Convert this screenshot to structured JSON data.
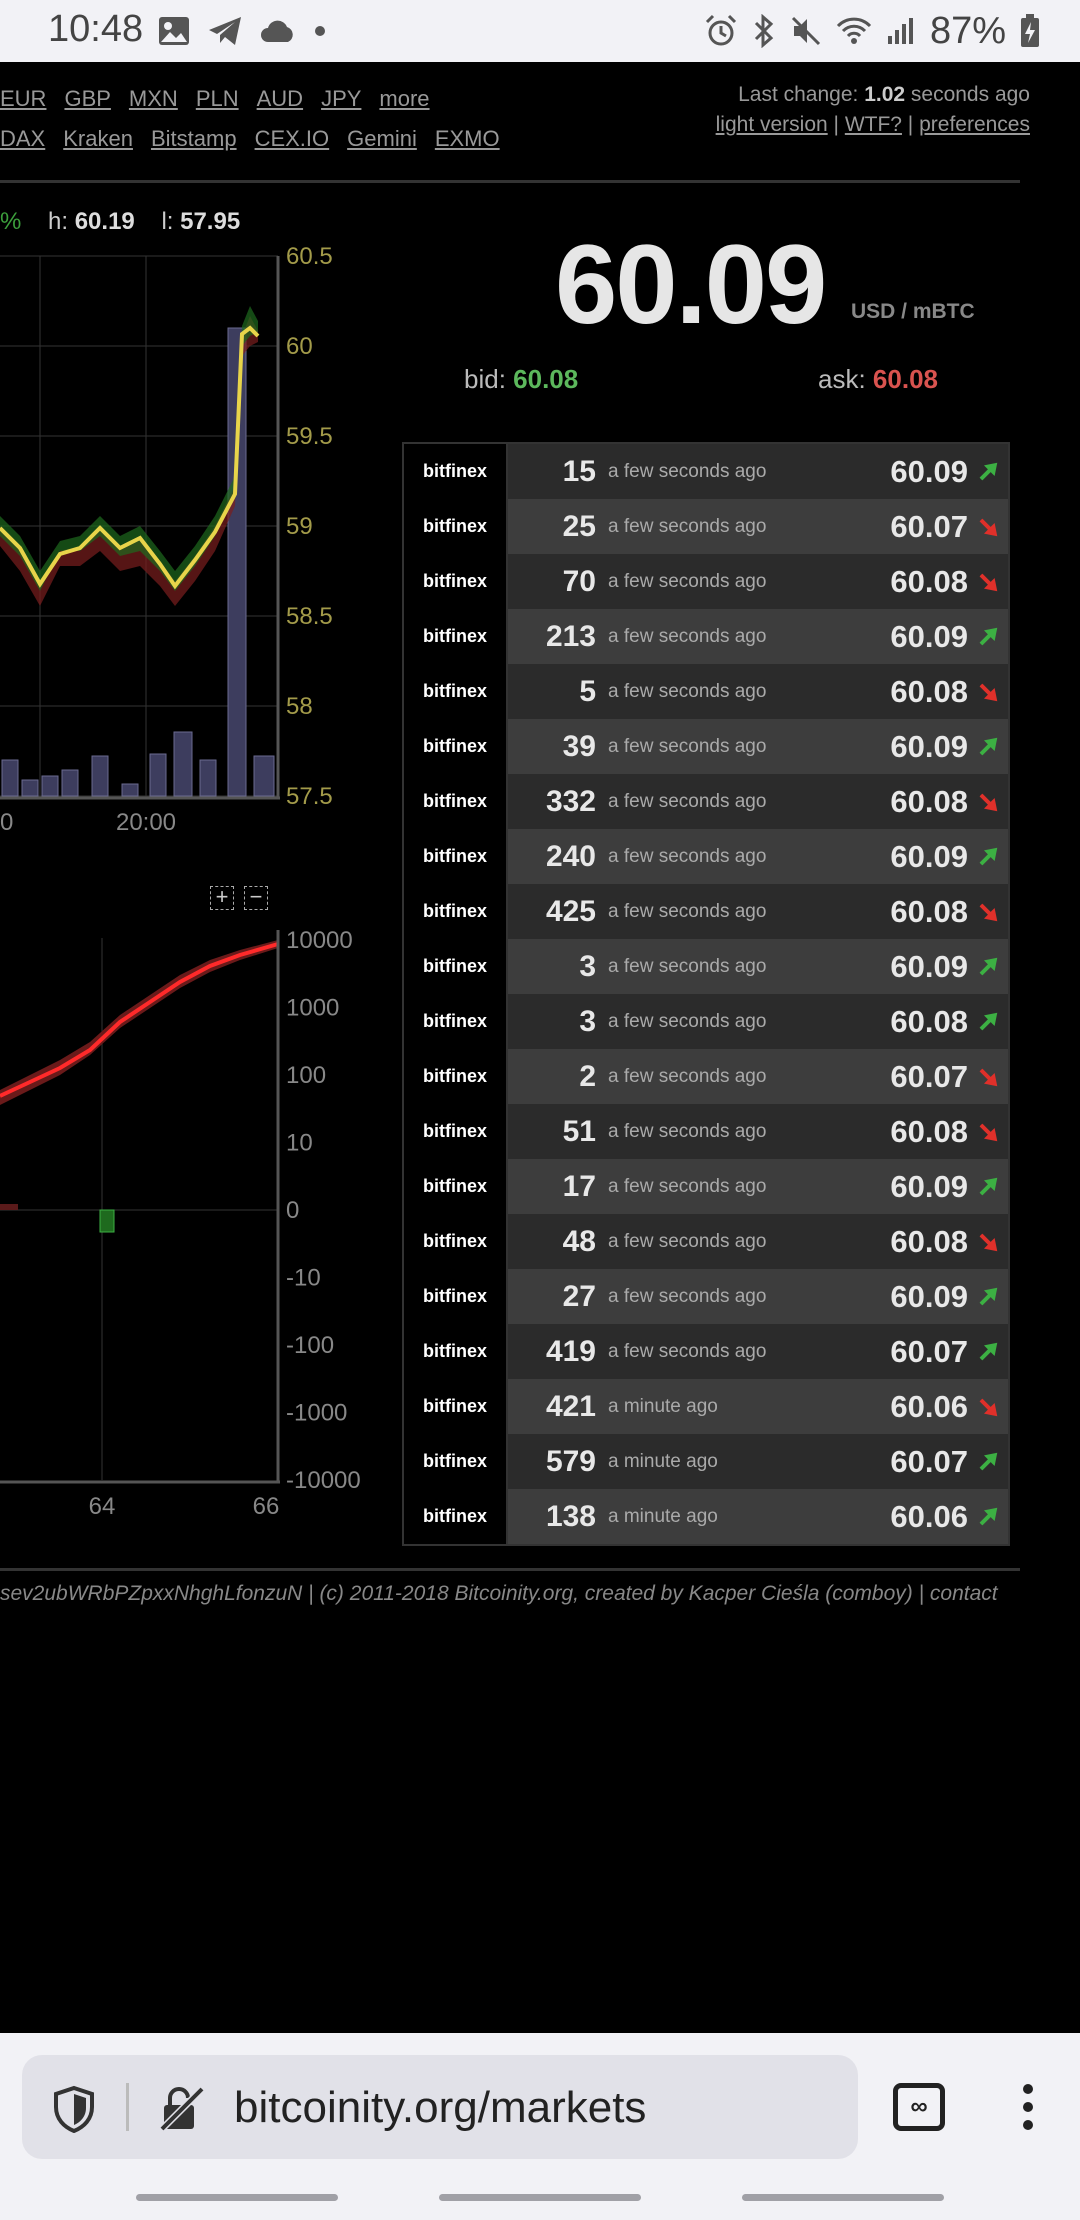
{
  "status_bar": {
    "time": "10:48",
    "battery": "87%"
  },
  "header": {
    "currencies": [
      "EUR",
      "GBP",
      "MXN",
      "PLN",
      "AUD",
      "JPY",
      "more"
    ],
    "exchanges": [
      "DAX",
      "Kraken",
      "Bitstamp",
      "CEX.IO",
      "Gemini",
      "EXMO"
    ],
    "last_change_prefix": "Last change: ",
    "last_change_value": "1.02",
    "last_change_suffix": " seconds ago",
    "links": [
      "light version",
      "WTF?",
      "preferences"
    ]
  },
  "stats": {
    "pct": "%",
    "high_label": "h: ",
    "high": "60.19",
    "low_label": "l: ",
    "low": "57.95"
  },
  "price": {
    "value": "60.09",
    "unit": "USD / mBTC",
    "bid_label": "bid: ",
    "bid": "60.08",
    "ask_label": "ask: ",
    "ask": "60.08"
  },
  "price_chart": {
    "y_ticks": [
      "60.5",
      "60",
      "59.5",
      "59",
      "58.5",
      "58",
      "57.5"
    ],
    "x_ticks": [
      "0",
      "20:00"
    ],
    "zoom_in": "+",
    "zoom_out": "−"
  },
  "depth_chart": {
    "y_ticks": [
      "10000",
      "1000",
      "100",
      "10",
      "0",
      "-10",
      "-100",
      "-1000",
      "-10000"
    ],
    "x_ticks": [
      "64",
      "66"
    ]
  },
  "colors": {
    "up": "#3cb043",
    "down": "#e0302a",
    "price_line": "#e8d44a"
  },
  "trades": [
    {
      "exchange": "bitfinex",
      "amount": "15",
      "ago": "a few seconds ago",
      "price": "60.09",
      "dir": "up"
    },
    {
      "exchange": "bitfinex",
      "amount": "25",
      "ago": "a few seconds ago",
      "price": "60.07",
      "dir": "down"
    },
    {
      "exchange": "bitfinex",
      "amount": "70",
      "ago": "a few seconds ago",
      "price": "60.08",
      "dir": "down"
    },
    {
      "exchange": "bitfinex",
      "amount": "213",
      "ago": "a few seconds ago",
      "price": "60.09",
      "dir": "up"
    },
    {
      "exchange": "bitfinex",
      "amount": "5",
      "ago": "a few seconds ago",
      "price": "60.08",
      "dir": "down"
    },
    {
      "exchange": "bitfinex",
      "amount": "39",
      "ago": "a few seconds ago",
      "price": "60.09",
      "dir": "up"
    },
    {
      "exchange": "bitfinex",
      "amount": "332",
      "ago": "a few seconds ago",
      "price": "60.08",
      "dir": "down"
    },
    {
      "exchange": "bitfinex",
      "amount": "240",
      "ago": "a few seconds ago",
      "price": "60.09",
      "dir": "up"
    },
    {
      "exchange": "bitfinex",
      "amount": "425",
      "ago": "a few seconds ago",
      "price": "60.08",
      "dir": "down"
    },
    {
      "exchange": "bitfinex",
      "amount": "3",
      "ago": "a few seconds ago",
      "price": "60.09",
      "dir": "up"
    },
    {
      "exchange": "bitfinex",
      "amount": "3",
      "ago": "a few seconds ago",
      "price": "60.08",
      "dir": "up"
    },
    {
      "exchange": "bitfinex",
      "amount": "2",
      "ago": "a few seconds ago",
      "price": "60.07",
      "dir": "down"
    },
    {
      "exchange": "bitfinex",
      "amount": "51",
      "ago": "a few seconds ago",
      "price": "60.08",
      "dir": "down"
    },
    {
      "exchange": "bitfinex",
      "amount": "17",
      "ago": "a few seconds ago",
      "price": "60.09",
      "dir": "up"
    },
    {
      "exchange": "bitfinex",
      "amount": "48",
      "ago": "a few seconds ago",
      "price": "60.08",
      "dir": "down"
    },
    {
      "exchange": "bitfinex",
      "amount": "27",
      "ago": "a few seconds ago",
      "price": "60.09",
      "dir": "up"
    },
    {
      "exchange": "bitfinex",
      "amount": "419",
      "ago": "a few seconds ago",
      "price": "60.07",
      "dir": "up"
    },
    {
      "exchange": "bitfinex",
      "amount": "421",
      "ago": "a minute ago",
      "price": "60.06",
      "dir": "down"
    },
    {
      "exchange": "bitfinex",
      "amount": "579",
      "ago": "a minute ago",
      "price": "60.07",
      "dir": "up"
    },
    {
      "exchange": "bitfinex",
      "amount": "138",
      "ago": "a minute ago",
      "price": "60.06",
      "dir": "up"
    }
  ],
  "footer": {
    "text": "sev2ubWRbPZpxxNhghLfonzuN | (c) 2011-2018 Bitcoinity.org, created by Kacper Cieśla (comboy) | ",
    "contact": "contact"
  },
  "browser": {
    "url": "bitcoinity.org/markets",
    "tabs_count": "∞"
  }
}
